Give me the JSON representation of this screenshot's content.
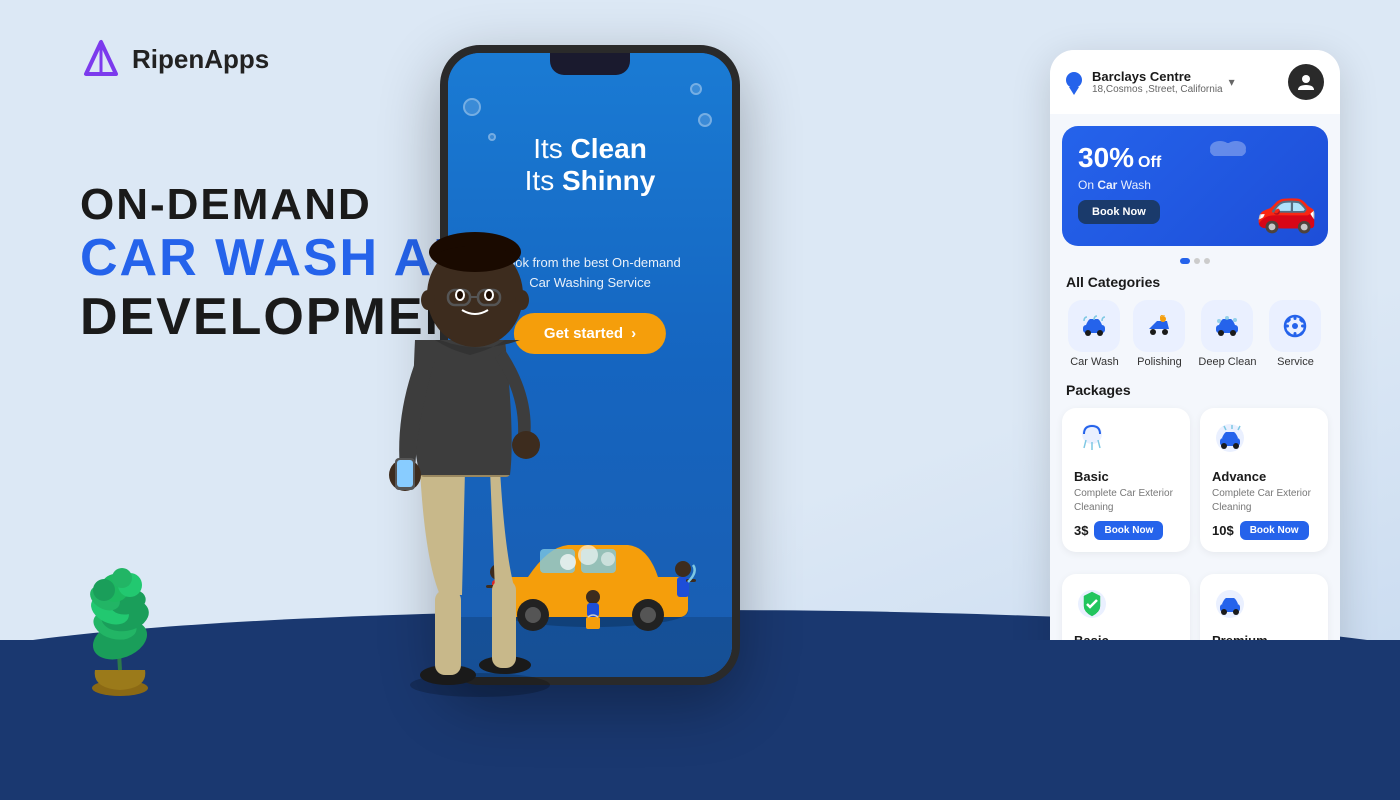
{
  "brand": {
    "name": "RipenApps",
    "logo_text": "RipenApps"
  },
  "hero": {
    "line1": "ON-DEMAND",
    "line2": "CAR WASH APP",
    "line3": "DEVELOPMENT"
  },
  "phone_screen": {
    "headline_regular1": "Its ",
    "headline_bold1": "Clean",
    "headline_regular2": "Its ",
    "headline_bold2": "Shinny",
    "subtext1": "Book from the best On-demand",
    "subtext2": "Car Washing Service",
    "cta_button": "Get started"
  },
  "app_panel": {
    "header": {
      "location_name": "Barclays Centre",
      "location_address": "18,Cosmos ,Street, California"
    },
    "promo": {
      "discount": "30%",
      "off_text": "Off",
      "desc": "On Car Wash",
      "button": "Book Now"
    },
    "categories_title": "All Categories",
    "categories": [
      {
        "label": "Car Wash",
        "icon": "🚗"
      },
      {
        "label": "Polishing",
        "icon": "✨"
      },
      {
        "label": "Deep Clean",
        "icon": "🚙"
      },
      {
        "label": "Service",
        "icon": "⚙️"
      }
    ],
    "packages_title": "Packages",
    "packages": [
      {
        "name": "Basic",
        "desc": "Complete Car Exterior Cleaning",
        "price": "3$",
        "button": "Book Now",
        "icon": "🚿"
      },
      {
        "name": "Advance",
        "desc": "Complete Car Exterior Cleaning",
        "price": "10$",
        "button": "Book Now",
        "icon": "🚗"
      }
    ],
    "packages_bottom": [
      {
        "name": "Basic",
        "icon": "🛡️"
      },
      {
        "name": "Premium",
        "icon": "🚙"
      }
    ]
  }
}
